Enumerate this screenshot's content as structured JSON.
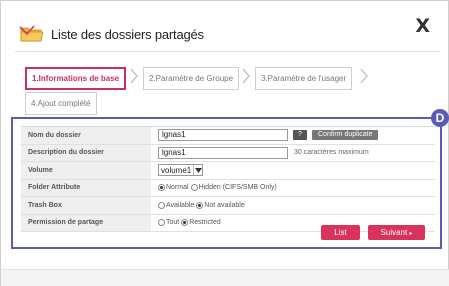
{
  "dialog": {
    "title": "Liste des dossiers partagés",
    "close_label": "X",
    "icon": "folder-share-icon"
  },
  "steps": [
    {
      "label": "1.Informations de base",
      "active": true
    },
    {
      "label": "2.Paramètre de Groupe",
      "active": false
    },
    {
      "label": "3.Paramètre de l'usager",
      "active": false
    },
    {
      "label": "4.Ajout complété",
      "active": false
    }
  ],
  "form": {
    "folder_name": {
      "label": "Nom du dossier",
      "value": "lgnas1",
      "help_label": "?",
      "confirm_label": "Confirm duplicate"
    },
    "description": {
      "label": "Description du dossier",
      "value": "lgnas1",
      "hint": "30 caractères maximum"
    },
    "volume": {
      "label": "Volume",
      "selected": "volume1"
    },
    "folder_attribute": {
      "label": "Folder Attribute",
      "options": [
        "Normal",
        "Hidden (CIFS/SMB Only)"
      ],
      "selected_index": 0
    },
    "trash_box": {
      "label": "Trash Box",
      "options": [
        "Available",
        "Not available"
      ],
      "selected_index": 1
    },
    "permission": {
      "label": "Permission de partage",
      "options": [
        "Tout",
        "Restricted"
      ],
      "selected_index": 1
    }
  },
  "buttons": {
    "list_label": "List",
    "next_label": "Suivant"
  },
  "annotation": {
    "badge_label": "D"
  },
  "colors": {
    "accent": "#d9335d",
    "highlight": "#5a5bb5"
  }
}
